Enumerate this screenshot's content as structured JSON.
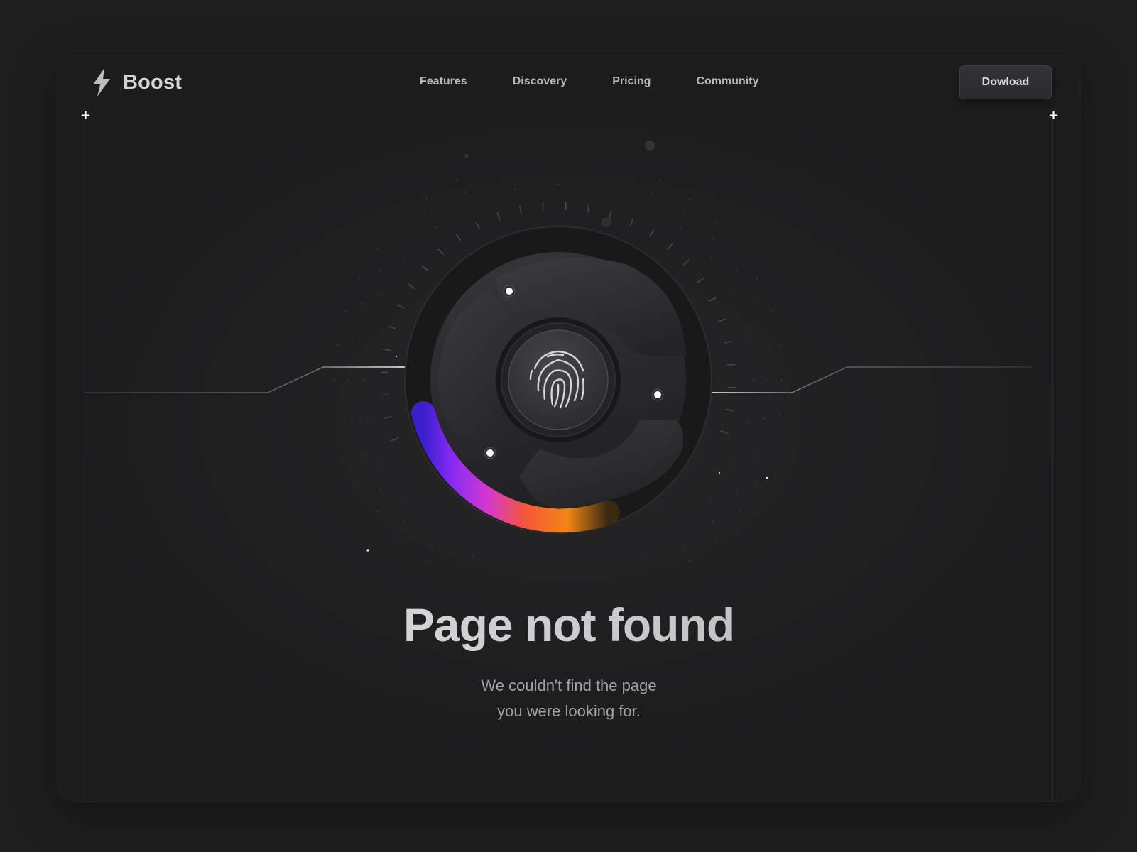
{
  "brand": {
    "name": "Boost",
    "logo_icon": "lightning-bolt-icon"
  },
  "nav": {
    "links": [
      "Features",
      "Discovery",
      "Pricing",
      "Community"
    ],
    "download_label": "Dowload"
  },
  "hero": {
    "title": "Page not found",
    "subtitle_line1": "We couldn't find the page",
    "subtitle_line2": "you were looking for.",
    "center_icon": "fingerprint-icon"
  },
  "colors": {
    "background": "#1c1c1d",
    "text_primary": "#d2d2d4",
    "accent_gradient": [
      "#6f2cff",
      "#b63cff",
      "#ff3d9a",
      "#ff7a1f",
      "#ffae00"
    ]
  }
}
